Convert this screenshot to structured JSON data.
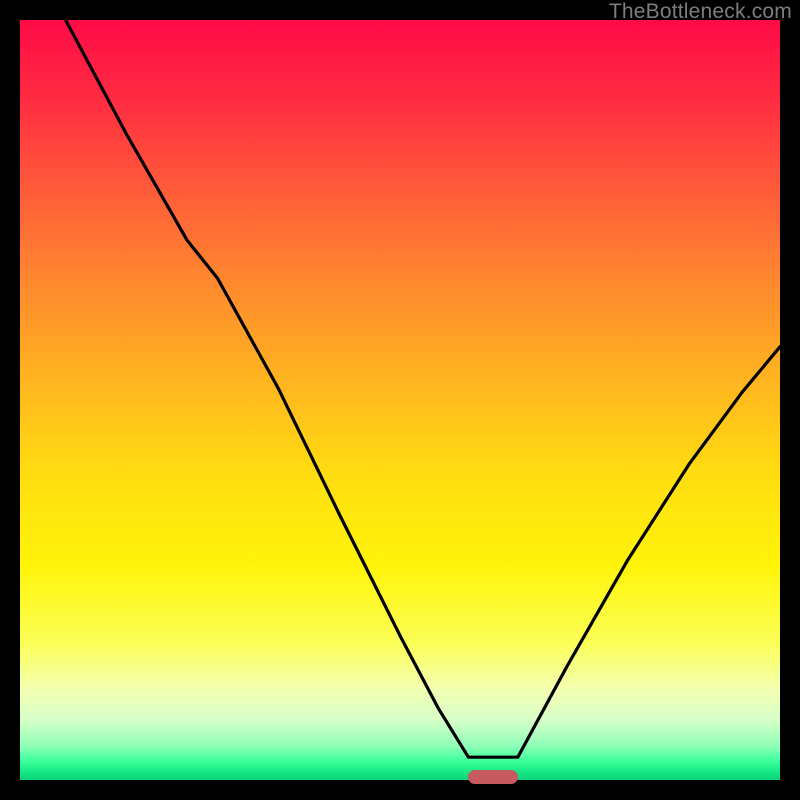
{
  "watermark": {
    "text": "TheBottleneck.com"
  },
  "marker": {
    "left_pct": 59.0,
    "width_pct": 6.5,
    "color": "#c75a5f"
  },
  "gradient": {
    "stops": [
      {
        "offset": 0.0,
        "color": "#ff0b46"
      },
      {
        "offset": 0.1,
        "color": "#ff2a42"
      },
      {
        "offset": 0.22,
        "color": "#ff5a3a"
      },
      {
        "offset": 0.35,
        "color": "#ff8a2e"
      },
      {
        "offset": 0.48,
        "color": "#ffb61f"
      },
      {
        "offset": 0.6,
        "color": "#ffdd10"
      },
      {
        "offset": 0.72,
        "color": "#fff40a"
      },
      {
        "offset": 0.82,
        "color": "#fbff58"
      },
      {
        "offset": 0.88,
        "color": "#f3ffb0"
      },
      {
        "offset": 0.92,
        "color": "#d8ffc8"
      },
      {
        "offset": 0.955,
        "color": "#8fffb8"
      },
      {
        "offset": 0.975,
        "color": "#3dff9a"
      },
      {
        "offset": 0.99,
        "color": "#14e884"
      },
      {
        "offset": 1.0,
        "color": "#0fd27a"
      }
    ]
  },
  "chart_data": {
    "type": "line",
    "title": "",
    "xlabel": "",
    "ylabel": "",
    "xlim": [
      0,
      100
    ],
    "ylim": [
      0,
      100
    ],
    "left_segment": {
      "x": [
        6.0,
        14.0,
        22.0,
        26.0,
        34.0,
        42.0,
        50.0,
        55.0,
        59.0
      ],
      "y_pctTop": [
        0.0,
        15.0,
        29.0,
        34.0,
        48.5,
        65.0,
        81.0,
        90.5,
        97.0
      ]
    },
    "plateau": {
      "x": [
        59.0,
        65.5
      ],
      "y_pctTop": [
        97.0,
        97.0
      ]
    },
    "right_segment": {
      "x": [
        65.5,
        72.0,
        80.0,
        88.0,
        95.0,
        100.0
      ],
      "y_pctTop": [
        97.0,
        85.0,
        71.0,
        58.5,
        49.0,
        43.0
      ]
    },
    "note": "y_pctTop = 0 is top of plot, 100 is bottom; curve is a bottleneck V shape"
  }
}
